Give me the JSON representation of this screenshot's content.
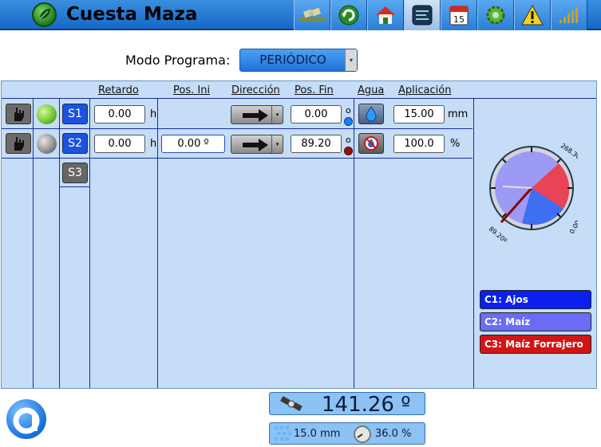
{
  "header": {
    "title": "Cuesta Maza",
    "toolbar": [
      "satellite-icon",
      "refresh-icon",
      "home-icon",
      "list-icon",
      "calendar-icon",
      "gear-icon",
      "warning-icon",
      "signal-icon"
    ],
    "calendar_day": "15"
  },
  "mode": {
    "label": "Modo Programa:",
    "value": "PERIÓDICO"
  },
  "columns": {
    "retardo": "Retardo",
    "pos_ini": "Pos. Ini",
    "direccion": "Dirección",
    "pos_fin": "Pos. Fin",
    "agua": "Agua",
    "aplicacion": "Aplicación"
  },
  "rows": [
    {
      "sector": "S1",
      "retardo": "0.00",
      "retardo_unit": "h",
      "pos_ini": "",
      "pos_fin": "0.00",
      "deg": "o",
      "aplicacion": "15.00",
      "aplicacion_unit": "mm"
    },
    {
      "sector": "S2",
      "retardo": "0.00",
      "retardo_unit": "h",
      "pos_ini": "0.00 º",
      "pos_fin": "89.20",
      "deg": "o",
      "aplicacion": "100.0",
      "aplicacion_unit": "%"
    }
  ],
  "sector3": "S3",
  "gauge": {
    "label_top": "268.30º",
    "label_right": "0.00",
    "label_left": "89.20º"
  },
  "crops": [
    {
      "label": "C1: Ajos",
      "color": "#0a1ff0"
    },
    {
      "label": "C2: Maíz",
      "color": "#6a6cf2"
    },
    {
      "label": "C3: Maíz Forrajero",
      "color": "#d11515"
    }
  ],
  "position": {
    "value": "141.26 º"
  },
  "info": {
    "water": "15.0 mm",
    "percent": "36.0 %"
  }
}
